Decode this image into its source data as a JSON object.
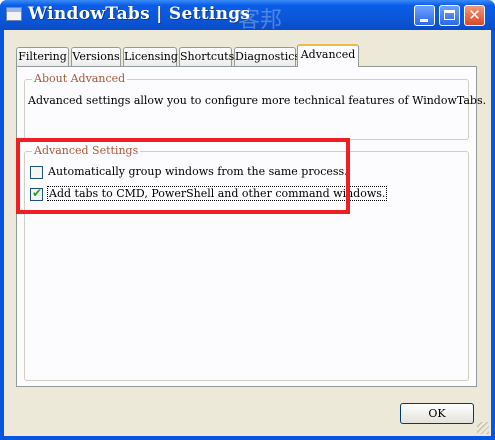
{
  "window": {
    "title": "WindowTabs | Settings",
    "watermark": "客邦",
    "controls": {
      "minimize": "minimize",
      "maximize": "maximize",
      "close": "✕"
    }
  },
  "tabs": [
    {
      "label": "Filtering"
    },
    {
      "label": "Versions"
    },
    {
      "label": "Licensing"
    },
    {
      "label": "Shortcuts"
    },
    {
      "label": "Diagnostics"
    },
    {
      "label": "Advanced",
      "active": true
    }
  ],
  "about": {
    "title": "About Advanced",
    "text": "Advanced settings allow you to configure more technical features of WindowTabs."
  },
  "advanced_settings": {
    "title": "Advanced Settings",
    "options": [
      {
        "label": "Automatically group windows from the same process.",
        "checked": false
      },
      {
        "label": "Add tabs to CMD, PowerShell and other command windows.",
        "checked": true
      }
    ]
  },
  "buttons": {
    "ok": "OK"
  },
  "colors": {
    "highlight": "#ee1e23",
    "group_title": "#a9573a",
    "titlebar": "#0b57d8"
  }
}
